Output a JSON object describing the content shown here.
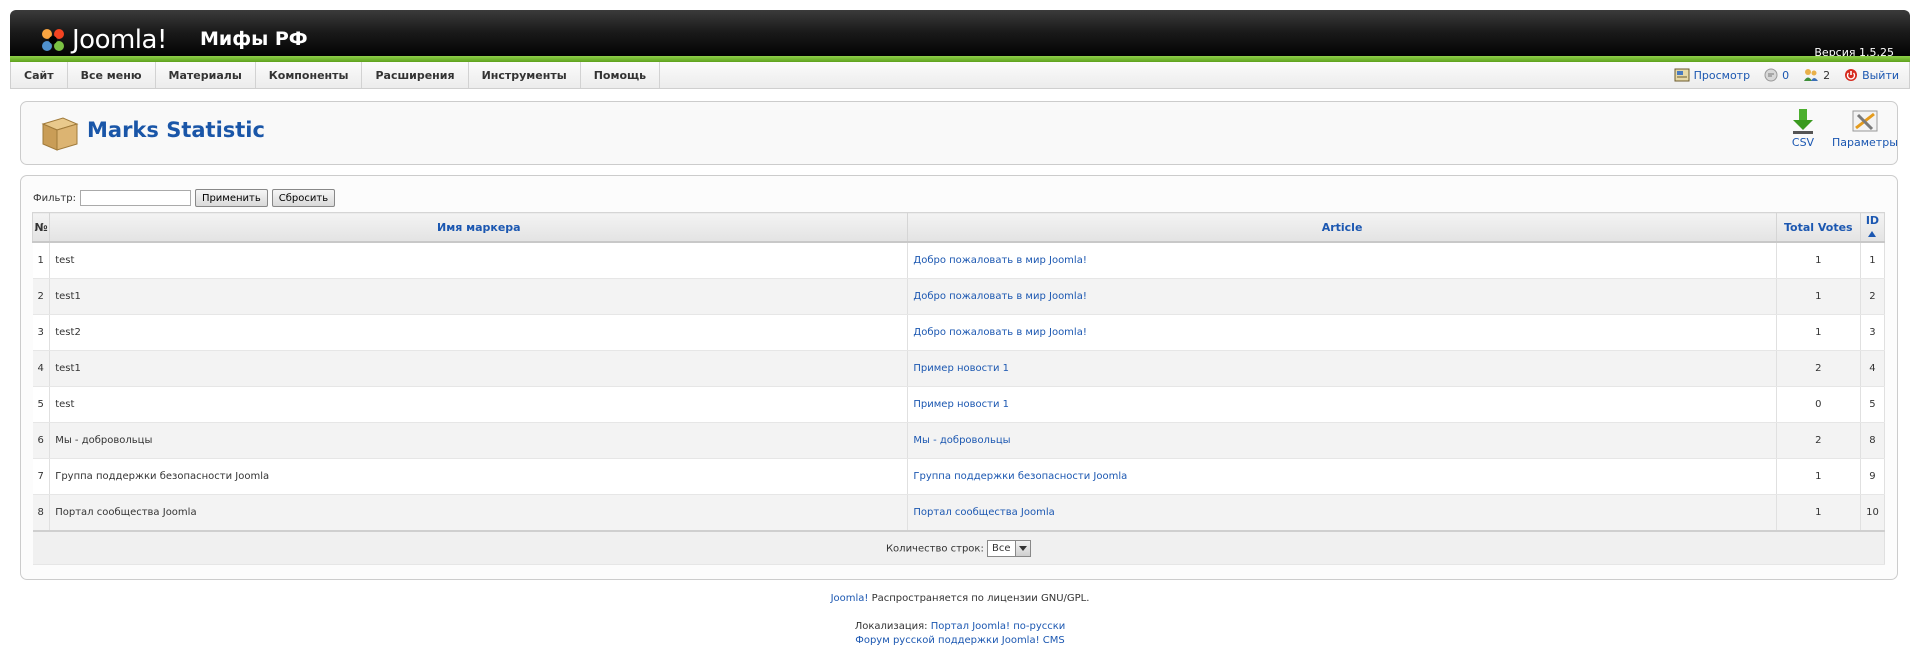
{
  "header": {
    "logo_text": "Joomla!",
    "site_title": "Мифы РФ",
    "version": "Версия 1.5.25"
  },
  "menu": {
    "items": [
      "Сайт",
      "Все меню",
      "Материалы",
      "Компоненты",
      "Расширения",
      "Инструменты",
      "Помощь"
    ]
  },
  "status": {
    "preview": "Просмотр",
    "messages_count": "0",
    "users_count": "2",
    "logout": "Выйти"
  },
  "toolbar": {
    "title": "Marks Statistic",
    "buttons": [
      {
        "label": "CSV",
        "icon": "download-icon"
      },
      {
        "label": "Параметры",
        "icon": "settings-icon"
      }
    ]
  },
  "filter": {
    "label": "Фильтр:",
    "value": "",
    "apply": "Применить",
    "reset": "Сбросить"
  },
  "table": {
    "columns": {
      "num": "№",
      "marker": "Имя маркера",
      "article": "Article",
      "votes": "Total Votes",
      "id": "ID"
    },
    "rows": [
      {
        "num": "1",
        "marker": "test",
        "article": "Добро пожаловать в мир Joomla!",
        "votes": "1",
        "id": "1"
      },
      {
        "num": "2",
        "marker": "test1",
        "article": "Добро пожаловать в мир Joomla!",
        "votes": "1",
        "id": "2"
      },
      {
        "num": "3",
        "marker": "test2",
        "article": "Добро пожаловать в мир Joomla!",
        "votes": "1",
        "id": "3"
      },
      {
        "num": "4",
        "marker": "test1",
        "article": "Пример новости 1",
        "votes": "2",
        "id": "4"
      },
      {
        "num": "5",
        "marker": "test",
        "article": "Пример новости 1",
        "votes": "0",
        "id": "5"
      },
      {
        "num": "6",
        "marker": "Мы - добровольцы",
        "article": "Мы - добровольцы",
        "votes": "2",
        "id": "8"
      },
      {
        "num": "7",
        "marker": "Группа поддержки безопасности Joomla",
        "article": "Группа поддержки безопасности Joomla",
        "votes": "1",
        "id": "9"
      },
      {
        "num": "8",
        "marker": "Портал сообщества Joomla",
        "article": "Портал сообщества Joomla",
        "votes": "1",
        "id": "10"
      }
    ],
    "footer_label": "Количество строк:",
    "rows_per_page": "Все"
  },
  "footer": {
    "joomla_link": "Joomla!",
    "license_text": " Распространяется по лицензии GNU/GPL.",
    "localization_label": "Локализация: ",
    "localization_link": "Портал Joomla! по-русски",
    "forum_link": "Форум русской поддержки Joomla! CMS"
  }
}
